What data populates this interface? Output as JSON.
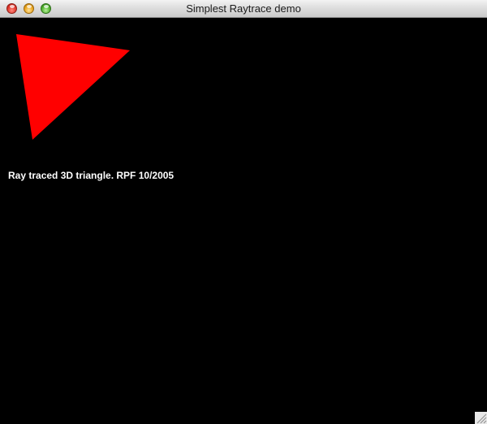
{
  "window": {
    "title": "Simplest Raytrace demo",
    "controls": {
      "close": "close-button",
      "minimize": "minimize-button",
      "zoom": "zoom-button"
    }
  },
  "canvas": {
    "background": "#000000",
    "caption": "Ray traced 3D triangle. RPF 10/2005",
    "caption_color": "#ffffff",
    "triangle_color": "#ff0000"
  }
}
